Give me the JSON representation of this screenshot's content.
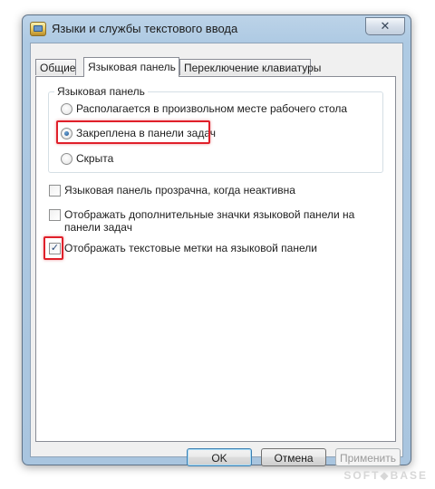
{
  "window": {
    "title": "Языки и службы текстового ввода",
    "close_symbol": "✕"
  },
  "tabs": [
    {
      "label": "Общие",
      "active": false
    },
    {
      "label": "Языковая панель",
      "active": true
    },
    {
      "label": "Переключение клавиатуры",
      "active": false
    }
  ],
  "group": {
    "legend": "Языковая панель",
    "options": [
      {
        "label": "Располагается в произвольном месте рабочего стола",
        "selected": false
      },
      {
        "label": "Закреплена в панели задач",
        "selected": true
      },
      {
        "label": "Скрыта",
        "selected": false
      }
    ]
  },
  "checkboxes": [
    {
      "label": "Языковая панель прозрачна, когда неактивна",
      "checked": false
    },
    {
      "label_line1": "Отображать дополнительные значки языковой панели на",
      "label_line2": "панели задач",
      "checked": false
    },
    {
      "label": "Отображать текстовые метки на языковой панели",
      "checked": true
    }
  ],
  "check_mark": "✓",
  "buttons": {
    "ok": "OK",
    "cancel": "Отмена",
    "apply": "Применить"
  },
  "watermark": "SOFT◆BASE",
  "colors": {
    "highlight": "#e0202a",
    "accent": "#3c7fb1"
  }
}
